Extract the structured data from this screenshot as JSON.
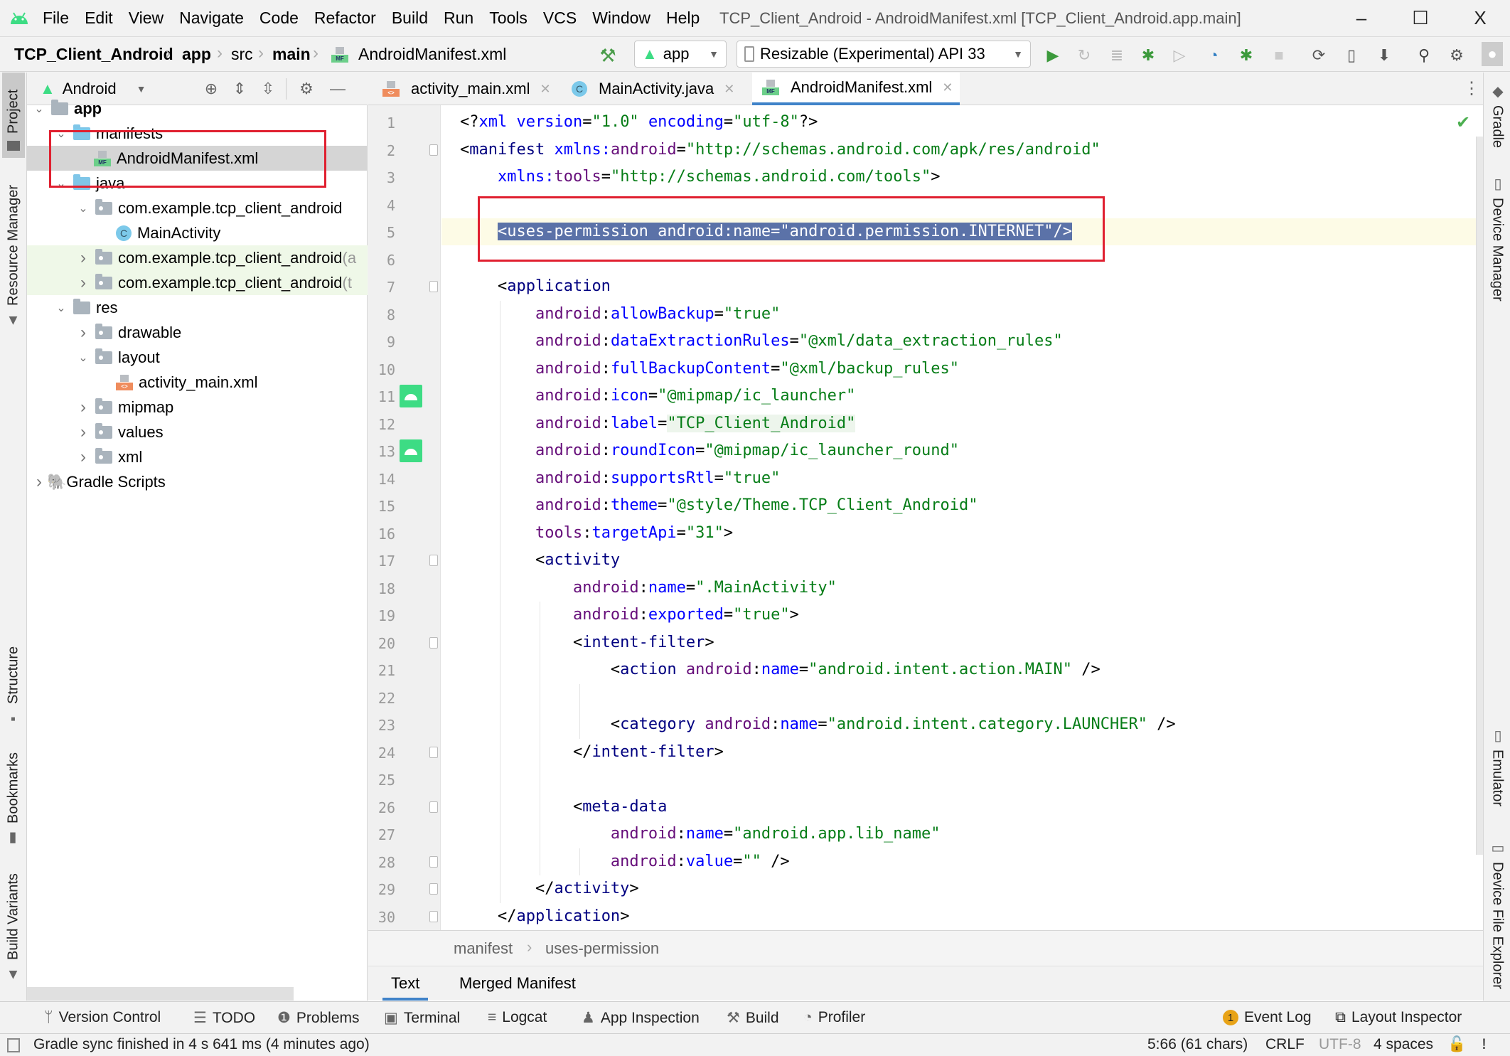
{
  "window": {
    "title": "TCP_Client_Android - AndroidManifest.xml [TCP_Client_Android.app.main]",
    "controls": {
      "minimize": "–",
      "maximize": "☐",
      "close": "X"
    }
  },
  "menu": [
    "File",
    "Edit",
    "View",
    "Navigate",
    "Code",
    "Refactor",
    "Build",
    "Run",
    "Tools",
    "VCS",
    "Window",
    "Help"
  ],
  "nav_breadcrumb": [
    "TCP_Client_Android",
    "app",
    "src",
    "main",
    "AndroidManifest.xml"
  ],
  "toolbar": {
    "run_config": "app",
    "device": "Resizable (Experimental) API 33",
    "icons": [
      "hammer-icon",
      "run-icon",
      "apply-changes-icon",
      "apply-code-changes-icon",
      "debug-icon",
      "attach-icon",
      "profile-icon",
      "attach-debugger-icon",
      "stop-icon",
      "gradle-sync-icon",
      "device-manager-icon",
      "sdk-manager-icon",
      "search-icon",
      "settings-icon",
      "avatar-icon"
    ]
  },
  "left_stripe": {
    "top": [
      {
        "label": "Project",
        "active": true
      },
      {
        "label": "Resource Manager",
        "active": false
      }
    ],
    "bottom": [
      {
        "label": "Structure"
      },
      {
        "label": "Bookmarks"
      },
      {
        "label": "Build Variants"
      }
    ]
  },
  "right_stripe": {
    "top": [
      "Gradle",
      "Device Manager"
    ],
    "bottom": [
      "Emulator",
      "Device File Explorer"
    ]
  },
  "project_panel": {
    "view_mode": "Android",
    "tree": [
      {
        "label": "app",
        "depth": 0,
        "expanded": true,
        "icon": "module",
        "bold": true
      },
      {
        "label": "manifests",
        "depth": 1,
        "expanded": true,
        "icon": "folder-blue"
      },
      {
        "label": "AndroidManifest.xml",
        "depth": 2,
        "icon": "manifest-file",
        "selected": true
      },
      {
        "label": "java",
        "depth": 1,
        "expanded": true,
        "icon": "folder-blue"
      },
      {
        "label": "com.example.tcp_client_android",
        "depth": 2,
        "expanded": true,
        "icon": "package"
      },
      {
        "label": "MainActivity",
        "depth": 3,
        "icon": "class"
      },
      {
        "label": "com.example.tcp_client_android (a",
        "depth": 2,
        "expanded": false,
        "icon": "package",
        "test": true
      },
      {
        "label": "com.example.tcp_client_android (t",
        "depth": 2,
        "expanded": false,
        "icon": "package",
        "test": true
      },
      {
        "label": "res",
        "depth": 1,
        "expanded": true,
        "icon": "res-folder"
      },
      {
        "label": "drawable",
        "depth": 2,
        "expanded": false,
        "icon": "package"
      },
      {
        "label": "layout",
        "depth": 2,
        "expanded": true,
        "icon": "package"
      },
      {
        "label": "activity_main.xml",
        "depth": 3,
        "icon": "layout-file"
      },
      {
        "label": "mipmap",
        "depth": 2,
        "expanded": false,
        "icon": "package"
      },
      {
        "label": "values",
        "depth": 2,
        "expanded": false,
        "icon": "package"
      },
      {
        "label": "xml",
        "depth": 2,
        "expanded": false,
        "icon": "package"
      },
      {
        "label": "Gradle Scripts",
        "depth": 0,
        "expanded": false,
        "icon": "gradle"
      }
    ]
  },
  "editor": {
    "tabs": [
      {
        "label": "activity_main.xml",
        "icon": "layout-file",
        "active": false
      },
      {
        "label": "MainActivity.java",
        "icon": "class",
        "active": false
      },
      {
        "label": "AndroidManifest.xml",
        "icon": "manifest-file",
        "active": true
      }
    ],
    "caret_line": 5,
    "selected_line": 5,
    "android_gutter_lines": [
      11,
      13
    ],
    "fold_lines": [
      2,
      7,
      17,
      20,
      24,
      26,
      28,
      29,
      30
    ],
    "lines": [
      [
        [
          "t-plain",
          "<?"
        ],
        [
          "t-attr",
          "xml version"
        ],
        [
          "t-plain",
          "="
        ],
        [
          "t-val",
          "\"1.0\""
        ],
        [
          "t-plain",
          " "
        ],
        [
          "t-attr",
          "encoding"
        ],
        [
          "t-plain",
          "="
        ],
        [
          "t-val",
          "\"utf-8\""
        ],
        [
          "t-plain",
          "?>"
        ]
      ],
      [
        [
          "t-plain",
          "<"
        ],
        [
          "t-tag",
          "manifest "
        ],
        [
          "t-attr",
          "xmlns:"
        ],
        [
          "t-ns",
          "android"
        ],
        [
          "t-plain",
          "="
        ],
        [
          "t-val",
          "\"http://schemas.android.com/apk/res/android\""
        ]
      ],
      [
        [
          "t-plain",
          "    "
        ],
        [
          "t-attr",
          "xmlns:"
        ],
        [
          "t-ns",
          "tools"
        ],
        [
          "t-plain",
          "="
        ],
        [
          "t-val",
          "\"http://schemas.android.com/tools\""
        ],
        [
          "t-plain",
          ">"
        ]
      ],
      [],
      [
        [
          "t-plain",
          "    "
        ],
        [
          "sel",
          "<uses-permission android:name=\"android.permission.INTERNET\"/>"
        ]
      ],
      [],
      [
        [
          "t-plain",
          "    <"
        ],
        [
          "t-tag",
          "application"
        ]
      ],
      [
        [
          "t-plain",
          "        "
        ],
        [
          "t-ns",
          "android"
        ],
        [
          "t-plain",
          ":"
        ],
        [
          "t-attr",
          "allowBackup"
        ],
        [
          "t-plain",
          "="
        ],
        [
          "t-val",
          "\"true\""
        ]
      ],
      [
        [
          "t-plain",
          "        "
        ],
        [
          "t-ns",
          "android"
        ],
        [
          "t-plain",
          ":"
        ],
        [
          "t-attr",
          "dataExtractionRules"
        ],
        [
          "t-plain",
          "="
        ],
        [
          "t-val",
          "\"@xml/data_extraction_rules\""
        ]
      ],
      [
        [
          "t-plain",
          "        "
        ],
        [
          "t-ns",
          "android"
        ],
        [
          "t-plain",
          ":"
        ],
        [
          "t-attr",
          "fullBackupContent"
        ],
        [
          "t-plain",
          "="
        ],
        [
          "t-val",
          "\"@xml/backup_rules\""
        ]
      ],
      [
        [
          "t-plain",
          "        "
        ],
        [
          "t-ns",
          "android"
        ],
        [
          "t-plain",
          ":"
        ],
        [
          "t-attr",
          "icon"
        ],
        [
          "t-plain",
          "="
        ],
        [
          "t-val",
          "\"@mipmap/ic_launcher\""
        ]
      ],
      [
        [
          "t-plain",
          "        "
        ],
        [
          "t-ns",
          "android"
        ],
        [
          "t-plain",
          ":"
        ],
        [
          "t-attr",
          "label"
        ],
        [
          "t-plain",
          "="
        ],
        [
          "t-val label",
          "\"TCP_Client_Android\""
        ]
      ],
      [
        [
          "t-plain",
          "        "
        ],
        [
          "t-ns",
          "android"
        ],
        [
          "t-plain",
          ":"
        ],
        [
          "t-attr",
          "roundIcon"
        ],
        [
          "t-plain",
          "="
        ],
        [
          "t-val",
          "\"@mipmap/ic_launcher_round\""
        ]
      ],
      [
        [
          "t-plain",
          "        "
        ],
        [
          "t-ns",
          "android"
        ],
        [
          "t-plain",
          ":"
        ],
        [
          "t-attr",
          "supportsRtl"
        ],
        [
          "t-plain",
          "="
        ],
        [
          "t-val",
          "\"true\""
        ]
      ],
      [
        [
          "t-plain",
          "        "
        ],
        [
          "t-ns",
          "android"
        ],
        [
          "t-plain",
          ":"
        ],
        [
          "t-attr",
          "theme"
        ],
        [
          "t-plain",
          "="
        ],
        [
          "t-val",
          "\"@style/Theme.TCP_Client_Android\""
        ]
      ],
      [
        [
          "t-plain",
          "        "
        ],
        [
          "t-ns",
          "tools"
        ],
        [
          "t-plain",
          ":"
        ],
        [
          "t-attr",
          "targetApi"
        ],
        [
          "t-plain",
          "="
        ],
        [
          "t-val",
          "\"31\""
        ],
        [
          "t-plain",
          ">"
        ]
      ],
      [
        [
          "t-plain",
          "        <"
        ],
        [
          "t-tag",
          "activity"
        ]
      ],
      [
        [
          "t-plain",
          "            "
        ],
        [
          "t-ns",
          "android"
        ],
        [
          "t-plain",
          ":"
        ],
        [
          "t-attr",
          "name"
        ],
        [
          "t-plain",
          "="
        ],
        [
          "t-val",
          "\".MainActivity\""
        ]
      ],
      [
        [
          "t-plain",
          "            "
        ],
        [
          "t-ns",
          "android"
        ],
        [
          "t-plain",
          ":"
        ],
        [
          "t-attr",
          "exported"
        ],
        [
          "t-plain",
          "="
        ],
        [
          "t-val",
          "\"true\""
        ],
        [
          "t-plain",
          ">"
        ]
      ],
      [
        [
          "t-plain",
          "            <"
        ],
        [
          "t-tag",
          "intent-filter"
        ],
        [
          "t-plain",
          ">"
        ]
      ],
      [
        [
          "t-plain",
          "                <"
        ],
        [
          "t-tag",
          "action "
        ],
        [
          "t-ns",
          "android"
        ],
        [
          "t-plain",
          ":"
        ],
        [
          "t-attr",
          "name"
        ],
        [
          "t-plain",
          "="
        ],
        [
          "t-val",
          "\"android.intent.action.MAIN\""
        ],
        [
          "t-plain",
          " />"
        ]
      ],
      [],
      [
        [
          "t-plain",
          "                <"
        ],
        [
          "t-tag",
          "category "
        ],
        [
          "t-ns",
          "android"
        ],
        [
          "t-plain",
          ":"
        ],
        [
          "t-attr",
          "name"
        ],
        [
          "t-plain",
          "="
        ],
        [
          "t-val",
          "\"android.intent.category.LAUNCHER\""
        ],
        [
          "t-plain",
          " />"
        ]
      ],
      [
        [
          "t-plain",
          "            </"
        ],
        [
          "t-tag",
          "intent-filter"
        ],
        [
          "t-plain",
          ">"
        ]
      ],
      [],
      [
        [
          "t-plain",
          "            <"
        ],
        [
          "t-tag",
          "meta-data"
        ]
      ],
      [
        [
          "t-plain",
          "                "
        ],
        [
          "t-ns",
          "android"
        ],
        [
          "t-plain",
          ":"
        ],
        [
          "t-attr",
          "name"
        ],
        [
          "t-plain",
          "="
        ],
        [
          "t-val",
          "\"android.app.lib_name\""
        ]
      ],
      [
        [
          "t-plain",
          "                "
        ],
        [
          "t-ns",
          "android"
        ],
        [
          "t-plain",
          ":"
        ],
        [
          "t-attr",
          "value"
        ],
        [
          "t-plain",
          "="
        ],
        [
          "t-val",
          "\"\""
        ],
        [
          "t-plain",
          " />"
        ]
      ],
      [
        [
          "t-plain",
          "        </"
        ],
        [
          "t-tag",
          "activity"
        ],
        [
          "t-plain",
          ">"
        ]
      ],
      [
        [
          "t-plain",
          "    </"
        ],
        [
          "t-tag",
          "application"
        ],
        [
          "t-plain",
          ">"
        ]
      ]
    ],
    "inspection_status": "no-problems",
    "structure_breadcrumb": [
      "manifest",
      "uses-permission"
    ],
    "bottom_tabs": [
      {
        "label": "Text",
        "active": true
      },
      {
        "label": "Merged Manifest",
        "active": false
      }
    ]
  },
  "tool_windows_bar": {
    "left": [
      {
        "label": "Version Control",
        "icon": "vcs-icon"
      },
      {
        "label": "TODO",
        "icon": "list-icon"
      },
      {
        "label": "Problems",
        "icon": "problems-icon"
      },
      {
        "label": "Terminal",
        "icon": "terminal-icon"
      },
      {
        "label": "Logcat",
        "icon": "logcat-icon"
      },
      {
        "label": "App Inspection",
        "icon": "app-inspection-icon"
      },
      {
        "label": "Build",
        "icon": "hammer-icon"
      },
      {
        "label": "Profiler",
        "icon": "profiler-icon"
      }
    ],
    "right": [
      {
        "label": "Event Log",
        "icon": "event-log-icon",
        "badge": "1"
      },
      {
        "label": "Layout Inspector",
        "icon": "layout-inspector-icon"
      }
    ]
  },
  "status_bar": {
    "message": "Gradle sync finished in 4 s 641 ms (4 minutes ago)",
    "position": "5:66 (61 chars)",
    "line_separator": "CRLF",
    "encoding": "UTF-8",
    "indent": "4 spaces"
  },
  "colors": {
    "accent": "#4083c9",
    "highlight_box": "#e02030",
    "selection": "#5b72a8",
    "android_green": "#3ddc84"
  }
}
